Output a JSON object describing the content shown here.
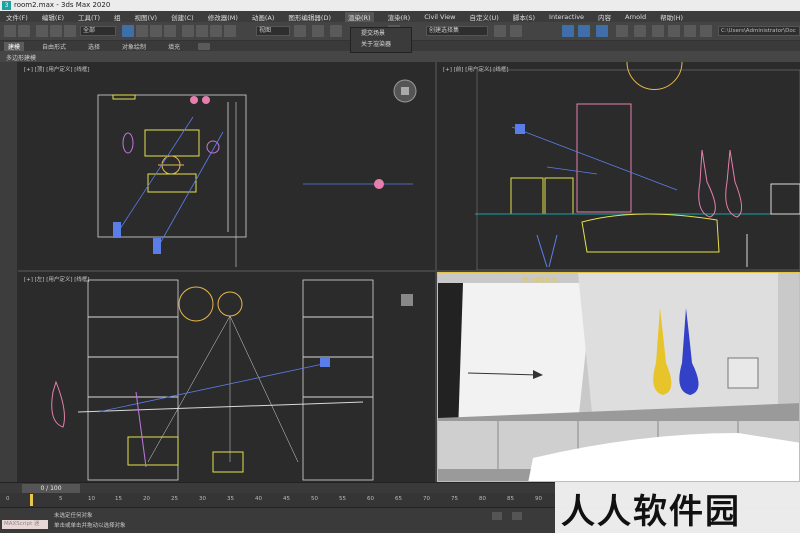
{
  "window": {
    "title": "room2.max - 3ds Max 2020",
    "app_icon": "3"
  },
  "menu": {
    "items": [
      "文件(F)",
      "编辑(E)",
      "工具(T)",
      "组",
      "视图(V)",
      "创建(C)",
      "修改器(M)",
      "动画(A)",
      "图形编辑器(D)",
      "渲染(R)",
      "渲染(R)",
      "Civil View",
      "自定义(U)",
      "脚本(S)",
      "Interactive",
      "内容",
      "Arnold",
      "帮助(H)"
    ],
    "active_index": 9
  },
  "dropdown": {
    "items": [
      "提交场景",
      "关于渲染器"
    ]
  },
  "toolbar": {
    "filter_select": "全部",
    "view_select": "视图",
    "selection_set": "创建选择集",
    "project_path": "C:\\Users\\Administrator\\Doc"
  },
  "ribbon": {
    "tabs": [
      "建模",
      "自由形式",
      "选择",
      "对象绘制",
      "填充"
    ],
    "active_index": 0,
    "sub_label": "多边形建模"
  },
  "viewports": {
    "top": {
      "label": "[+] [顶] [用户定义] [线框]"
    },
    "front": {
      "label": "[+] [前] [用户定义] [线框]"
    },
    "left": {
      "label": "[+] [左] [用户定义] [线框]"
    },
    "camera": {
      "label_prefix": "[+] [Camera001] [用户定义] ",
      "label_highlight": "[默认明暗处理]"
    }
  },
  "timeline": {
    "frame_label": "0 / 100",
    "ticks": [
      "0",
      "5",
      "10",
      "15",
      "20",
      "25",
      "30",
      "35",
      "40",
      "45",
      "50",
      "55",
      "60",
      "65",
      "70",
      "75",
      "80",
      "85",
      "90"
    ]
  },
  "status": {
    "maxscript_label": "MAXScript 迷",
    "line1": "未选定任何对象",
    "line2": "单击或单击并拖动以选择对象"
  },
  "watermark": {
    "text": "人人软件园"
  },
  "colors": {
    "accent_selection": "#3f6ea8",
    "camera_border": "#e3c44a",
    "wire_yellow": "#e6e04a",
    "wire_pink": "#e67fae",
    "wire_blue": "#5b7de8"
  }
}
